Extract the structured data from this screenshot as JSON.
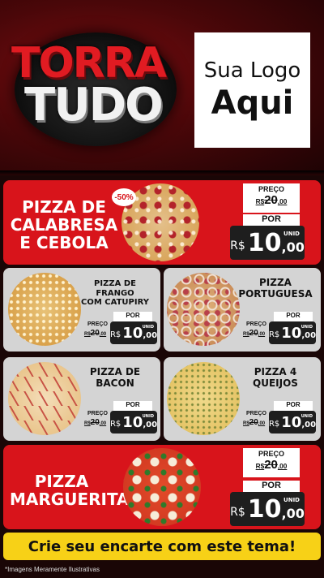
{
  "header": {
    "brand_line1": "TORRA",
    "brand_line2": "TUDO",
    "logo_line1": "Sua Logo",
    "logo_line2": "Aqui"
  },
  "featured_1": {
    "name_line1": "PIZZA DE",
    "name_line2": "CALABRESA",
    "name_line3": "E CEBOLA",
    "badge": "-50%",
    "preco_label": "PREÇO",
    "old_currency": "R$",
    "old_price": "20",
    "old_cents": ",00",
    "por_label": "POR",
    "currency": "R$",
    "price": "10",
    "cents": ",00",
    "unit": "UNID"
  },
  "products": [
    {
      "name_line1": "PIZZA DE FRANGO",
      "name_line2": "COM CATUPIRY",
      "preco_label": "PREÇO",
      "old_currency": "R$",
      "old_price": "20",
      "old_cents": ",00",
      "por_label": "POR",
      "currency": "R$",
      "price": "10",
      "cents": ",00",
      "unit": "UNID"
    },
    {
      "name_line1": "PIZZA",
      "name_line2": "PORTUGUESA",
      "preco_label": "PREÇO",
      "old_currency": "R$",
      "old_price": "20",
      "old_cents": ",00",
      "por_label": "POR",
      "currency": "R$",
      "price": "10",
      "cents": ",00",
      "unit": "UNID"
    },
    {
      "name_line1": "PIZZA DE",
      "name_line2": "BACON",
      "preco_label": "PREÇO",
      "old_currency": "R$",
      "old_price": "20",
      "old_cents": ",00",
      "por_label": "POR",
      "currency": "R$",
      "price": "10",
      "cents": ",00",
      "unit": "UNID"
    },
    {
      "name_line1": "PIZZA 4",
      "name_line2": "QUEIJOS",
      "preco_label": "PREÇO",
      "old_currency": "R$",
      "old_price": "20",
      "old_cents": ",00",
      "por_label": "POR",
      "currency": "R$",
      "price": "10",
      "cents": ",00",
      "unit": "UNID"
    }
  ],
  "featured_2": {
    "name_line1": "PIZZA",
    "name_line2": "MARGUERITA",
    "preco_label": "PREÇO",
    "old_currency": "R$",
    "old_price": "20",
    "old_cents": ",00",
    "por_label": "POR",
    "currency": "R$",
    "price": "10",
    "cents": ",00",
    "unit": "UNID"
  },
  "footer": {
    "cta": "Crie seu encarte com este tema!",
    "disclaimer": "*Imagens Meramente Ilustrativas"
  },
  "colors": {
    "primary_red": "#d8141b",
    "card_gray": "#d4d4d4",
    "price_dark": "#1e1e1e",
    "cta_yellow": "#f7d117"
  }
}
